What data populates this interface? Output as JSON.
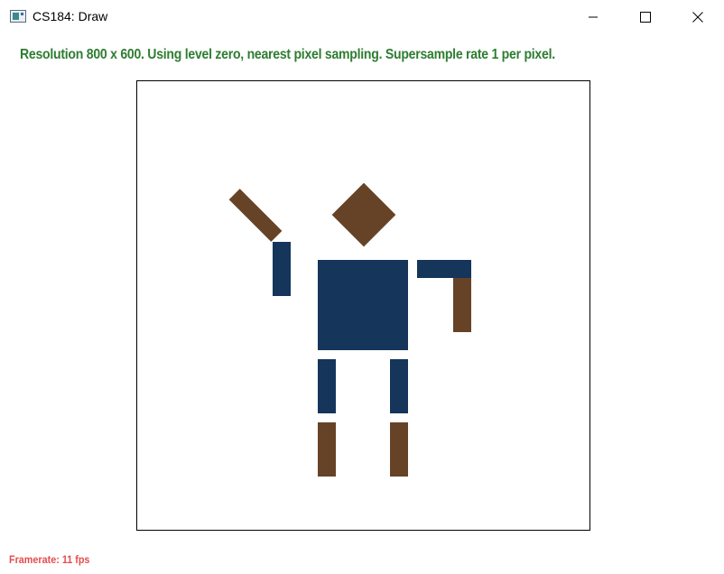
{
  "window": {
    "title": "CS184: Draw",
    "icon": "app-window-icon",
    "controls": [
      "minimize-icon",
      "maximize-icon",
      "close-icon"
    ]
  },
  "status": {
    "text": "Resolution 800 x 600. Using level zero, nearest pixel sampling. Supersample rate 1 per pixel.",
    "color": "#2e7d32"
  },
  "footer": {
    "framerate": "Framerate: 11 fps",
    "color": "#e64c4c"
  },
  "colors": {
    "body": "#15355a",
    "limbs": "#664326",
    "canvas_bg": "#ffffff"
  }
}
